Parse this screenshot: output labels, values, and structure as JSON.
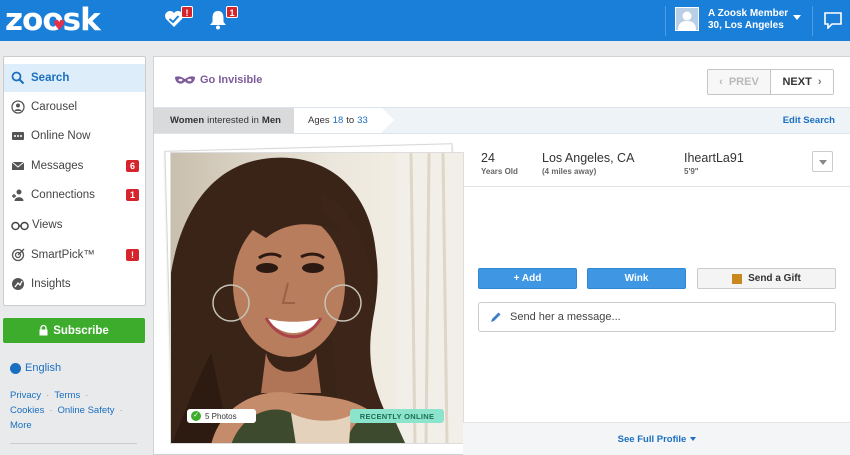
{
  "header": {
    "logo": "zoosk",
    "matches_badge": "!",
    "alerts_badge": "1",
    "member_name": "A Zoosk Member",
    "member_sub": "30, Los Angeles"
  },
  "sidebar": {
    "items": [
      {
        "label": "Search",
        "icon": "search-icon"
      },
      {
        "label": "Carousel",
        "icon": "carousel-icon"
      },
      {
        "label": "Online Now",
        "icon": "chat-dots-icon"
      },
      {
        "label": "Messages",
        "icon": "envelope-icon",
        "badge": "6"
      },
      {
        "label": "Connections",
        "icon": "connections-icon",
        "badge": "1"
      },
      {
        "label": "Views",
        "icon": "glasses-icon"
      },
      {
        "label": "SmartPick™",
        "icon": "target-icon",
        "badge": "!"
      },
      {
        "label": "Insights",
        "icon": "insights-icon"
      }
    ],
    "subscribe": "Subscribe",
    "language": "English",
    "links": [
      "Privacy",
      "Terms",
      "Cookies",
      "Online Safety",
      "More"
    ]
  },
  "main": {
    "go_invisible": "Go Invisible",
    "prev": "PREV",
    "next": "NEXT",
    "filter_women": "Women",
    "filter_mid": "interested in",
    "filter_men": "Men",
    "ages_label": "Ages",
    "age_min": "18",
    "age_to": "to",
    "age_max": "33",
    "edit_search": "Edit Search",
    "photos_count": "5 Photos",
    "recently_online": "RECENTLY ONLINE"
  },
  "profile": {
    "age": "24",
    "age_sub": "Years Old",
    "location": "Los Angeles, CA",
    "distance": "(4 miles away)",
    "username": "IheartLa91",
    "height": "5'9\"",
    "add_button": "+ Add",
    "wink_button": "Wink",
    "gift_button": "Send a Gift",
    "message_placeholder": "Send her a message...",
    "see_full_profile": "See Full Profile"
  },
  "colors": {
    "topbar": "#1a7fd8",
    "link": "#1a6fc0",
    "subscribe": "#3dac2d",
    "badge": "#d5242c",
    "invisible": "#7d5b9b",
    "recent": "#8be4cb"
  }
}
